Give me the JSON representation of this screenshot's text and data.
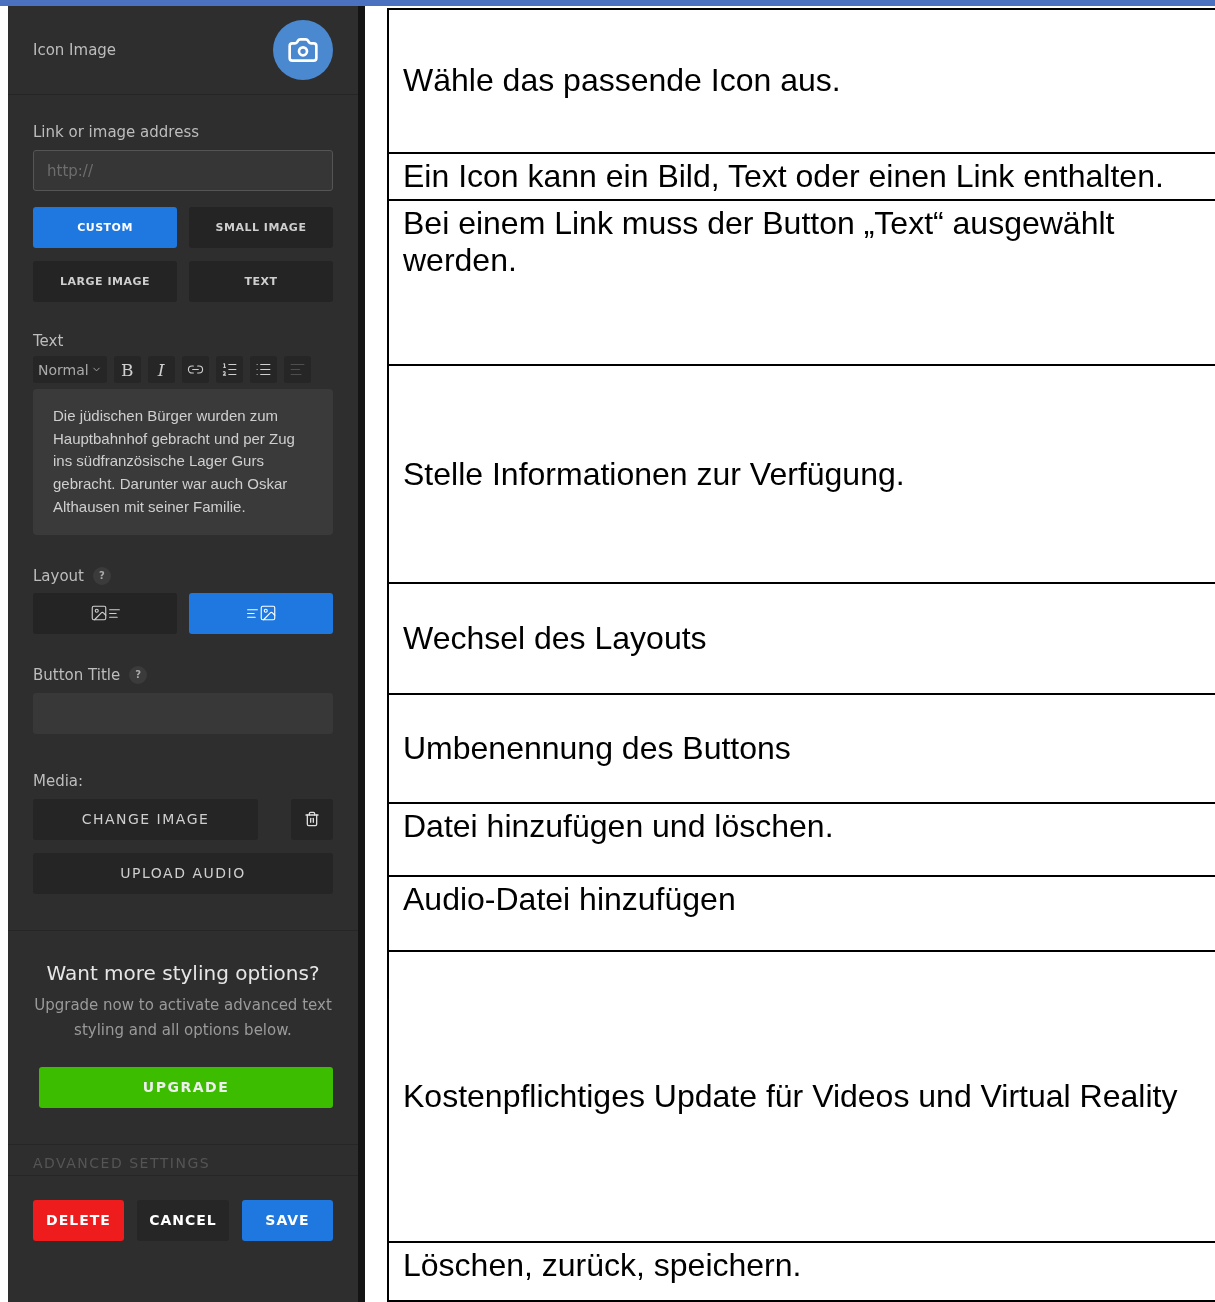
{
  "panel": {
    "icon_image": {
      "label": "Icon Image"
    },
    "link": {
      "label": "Link or image address",
      "placeholder": "http://"
    },
    "display_options": [
      {
        "label": "CUSTOM",
        "selected": true
      },
      {
        "label": "SMALL IMAGE",
        "selected": false
      },
      {
        "label": "LARGE IMAGE",
        "selected": false
      },
      {
        "label": "TEXT",
        "selected": false
      }
    ],
    "text": {
      "label": "Text",
      "format": "Normal",
      "body": "Die jüdischen Bürger wurden zum Hauptbahnhof gebracht und per Zug ins südfranzösische Lager Gurs gebracht. Darunter war auch Oskar Althausen mit seiner Familie.",
      "toolbar": [
        {
          "kind": "bold",
          "glyph": "B",
          "disabled": false
        },
        {
          "kind": "italic",
          "glyph": "I",
          "disabled": false
        },
        {
          "kind": "link",
          "disabled": false
        },
        {
          "kind": "ordered-list",
          "disabled": false
        },
        {
          "kind": "bullet-list",
          "disabled": false
        },
        {
          "kind": "align",
          "disabled": true
        }
      ]
    },
    "layout": {
      "label": "Layout",
      "help": "?",
      "options": [
        {
          "kind": "image-left",
          "selected": false
        },
        {
          "kind": "image-right",
          "selected": true
        }
      ]
    },
    "button_title": {
      "label": "Button Title",
      "help": "?"
    },
    "media": {
      "label": "Media:",
      "change": "CHANGE IMAGE",
      "upload": "UPLOAD AUDIO"
    },
    "upgrade": {
      "title": "Want more styling options?",
      "body": "Upgrade now to activate advanced text styling and all options below.",
      "button": "UPGRADE"
    },
    "advanced": "ADVANCED SETTINGS",
    "footer": [
      {
        "kind": "danger",
        "label": "DELETE"
      },
      {
        "kind": "neutral",
        "label": "CANCEL"
      },
      {
        "kind": "primary",
        "label": "SAVE"
      }
    ]
  },
  "table": {
    "rows": [
      "Wähle das passende Icon aus.",
      "Ein Icon kann ein Bild, Text oder einen Link enthalten.",
      "Bei einem Link muss der Button „Text“ ausgewählt werden.",
      "Stelle Informationen zur Verfügung.",
      "Wechsel des Layouts",
      "Umbenennung des Buttons",
      "Datei hinzufügen und löschen.",
      "Audio-Datei hinzufügen",
      "Kostenpflichtiges Update für Videos und Virtual Reality",
      "Löschen, zurück, speichern."
    ]
  }
}
